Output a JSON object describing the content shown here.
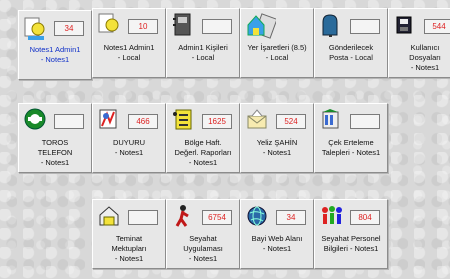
{
  "tiles": [
    {
      "icon": "notes-user-icon",
      "badge": "34",
      "label": "Notes1 Admin1\n- Notes1"
    },
    {
      "icon": "notes-user-icon",
      "badge": "10",
      "label": "Notes1 Admin1\n- Local"
    },
    {
      "icon": "address-book-icon",
      "badge": "",
      "label": "Admin1 Kişileri\n- Local"
    },
    {
      "icon": "bookmarks-icon",
      "badge": "",
      "label": "Yer İşaretleri (8.5)\n- Local"
    },
    {
      "icon": "outbox-mailbox-icon",
      "badge": "",
      "label": "Gönderilecek\nPosta - Local"
    },
    {
      "icon": "user-files-icon",
      "badge": "544",
      "label": "Kullanıcı\nDosyaları\n- Notes1"
    },
    {
      "icon": "phone-icon",
      "badge": "",
      "label": "TOROS\nTELEFON\n- Notes1"
    },
    {
      "icon": "announcement-icon",
      "badge": "466",
      "label": "DUYURU\n- Notes1"
    },
    {
      "icon": "report-icon",
      "badge": "1625",
      "label": "Bölge Haft.\nDeğerl. Raporları\n- Notes1"
    },
    {
      "icon": "mail-envelope-icon",
      "badge": "524",
      "label": "Yeliz ŞAHİN\n- Notes1"
    },
    {
      "icon": "check-cash-icon",
      "badge": "",
      "label": "Çek Erteleme\nTalepleri - Notes1"
    },
    {
      "icon": "house-letter-icon",
      "badge": "",
      "label": "Teminat\nMektupları\n- Notes1"
    },
    {
      "icon": "traveler-icon",
      "badge": "6754",
      "label": "Seyahat\nUygulaması\n- Notes1"
    },
    {
      "icon": "globe-web-icon",
      "badge": "34",
      "label": "Bayi Web Alanı\n- Notes1"
    },
    {
      "icon": "people-group-icon",
      "badge": "804",
      "label": "Seyahat Personel\nBilgileri - Notes1"
    }
  ]
}
